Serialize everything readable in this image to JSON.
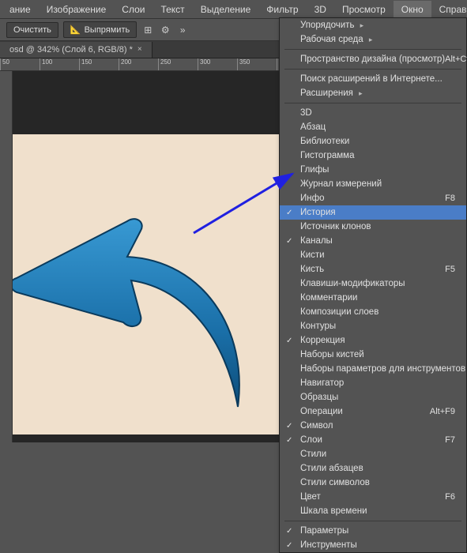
{
  "menubar": [
    "ание",
    "Изображение",
    "Слои",
    "Текст",
    "Выделение",
    "Фильтр",
    "3D",
    "Просмотр",
    "Окно",
    "Справка"
  ],
  "activeMenuIndex": 8,
  "toolbar": {
    "clear": "Очистить",
    "align": "Выпрямить"
  },
  "docTab": "osd @ 342% (Слой 6, RGB/8) *",
  "rulerStart": 50,
  "rulerStep": 50,
  "rulerCount": 8,
  "dropdown": [
    {
      "label": "Упорядочить",
      "sub": true
    },
    {
      "label": "Рабочая среда",
      "sub": true
    },
    {
      "sep": true
    },
    {
      "label": "Пространство дизайна (просмотр)",
      "shortcut": "Alt+Ctrl+`"
    },
    {
      "sep": true
    },
    {
      "label": "Поиск расширений в Интернете..."
    },
    {
      "label": "Расширения",
      "sub": true
    },
    {
      "sep": true
    },
    {
      "label": "3D"
    },
    {
      "label": "Абзац"
    },
    {
      "label": "Библиотеки"
    },
    {
      "label": "Гистограмма"
    },
    {
      "label": "Глифы"
    },
    {
      "label": "Журнал измерений"
    },
    {
      "label": "Инфо",
      "shortcut": "F8"
    },
    {
      "label": "История",
      "checked": true,
      "highlight": true
    },
    {
      "label": "Источник клонов"
    },
    {
      "label": "Каналы",
      "checked": true
    },
    {
      "label": "Кисти"
    },
    {
      "label": "Кисть",
      "shortcut": "F5"
    },
    {
      "label": "Клавиши-модификаторы"
    },
    {
      "label": "Комментарии"
    },
    {
      "label": "Композиции слоев"
    },
    {
      "label": "Контуры"
    },
    {
      "label": "Коррекция",
      "checked": true
    },
    {
      "label": "Наборы кистей"
    },
    {
      "label": "Наборы параметров для инструментов"
    },
    {
      "label": "Навигатор"
    },
    {
      "label": "Образцы"
    },
    {
      "label": "Операции",
      "shortcut": "Alt+F9"
    },
    {
      "label": "Символ",
      "checked": true
    },
    {
      "label": "Слои",
      "checked": true,
      "shortcut": "F7"
    },
    {
      "label": "Стили"
    },
    {
      "label": "Стили абзацев"
    },
    {
      "label": "Стили символов"
    },
    {
      "label": "Цвет",
      "shortcut": "F6"
    },
    {
      "label": "Шкала времени"
    },
    {
      "sep": true
    },
    {
      "label": "Параметры",
      "checked": true
    },
    {
      "label": "Инструменты",
      "checked": true
    }
  ]
}
